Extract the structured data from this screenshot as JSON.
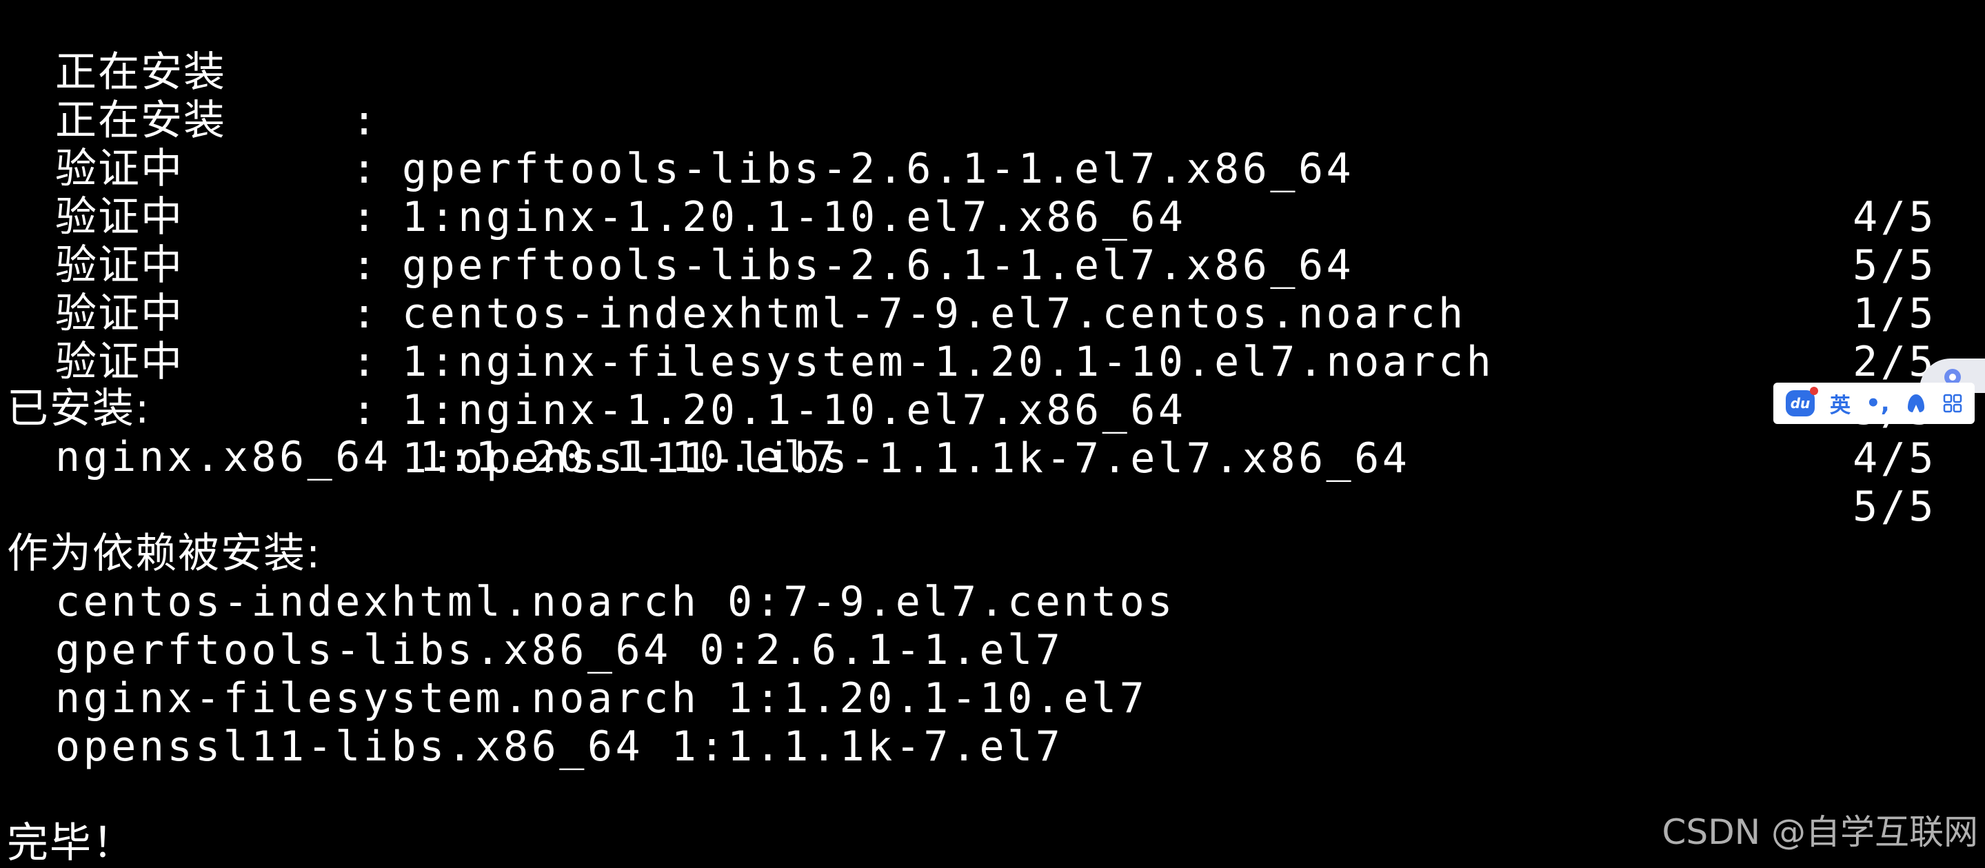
{
  "terminal": {
    "progress_lines": [
      {
        "op": "正在安装",
        "package": "gperftools-libs-2.6.1-1.el7.x86_64",
        "count": "4/5"
      },
      {
        "op": "正在安装",
        "package": "1:nginx-1.20.1-10.el7.x86_64",
        "count": "5/5"
      },
      {
        "op": "验证中",
        "package": "gperftools-libs-2.6.1-1.el7.x86_64",
        "count": "1/5"
      },
      {
        "op": "验证中",
        "package": "centos-indexhtml-7-9.el7.centos.noarch",
        "count": "2/5"
      },
      {
        "op": "验证中",
        "package": "1:nginx-filesystem-1.20.1-10.el7.noarch",
        "count": "3/5"
      },
      {
        "op": "验证中",
        "package": "1:nginx-1.20.1-10.el7.x86_64",
        "count": "4/5"
      },
      {
        "op": "验证中",
        "package": "1:openssl11-libs-1.1.1k-7.el7.x86_64",
        "count": "5/5"
      }
    ],
    "separator": ":",
    "installed_heading": "已安装:",
    "installed": [
      "nginx.x86_64 1:1.20.1-10.el7"
    ],
    "dependency_heading": "作为依赖被安装:",
    "dependencies": [
      "centos-indexhtml.noarch 0:7-9.el7.centos",
      "gperftools-libs.x86_64 0:2.6.1-1.el7",
      "nginx-filesystem.noarch 1:1.20.1-10.el7",
      "openssl11-libs.x86_64 1:1.1.1k-7.el7"
    ],
    "complete": "完毕！"
  },
  "ime_toolbar": {
    "logo_text": "du",
    "language": "英",
    "punctuation": "•,",
    "icons": [
      "baidu-ime-logo-icon",
      "skin-icon",
      "grid-menu-icon",
      "float-ball-icon"
    ],
    "accent_color": "#2f6fe6"
  },
  "watermark": "CSDN @自学互联网"
}
